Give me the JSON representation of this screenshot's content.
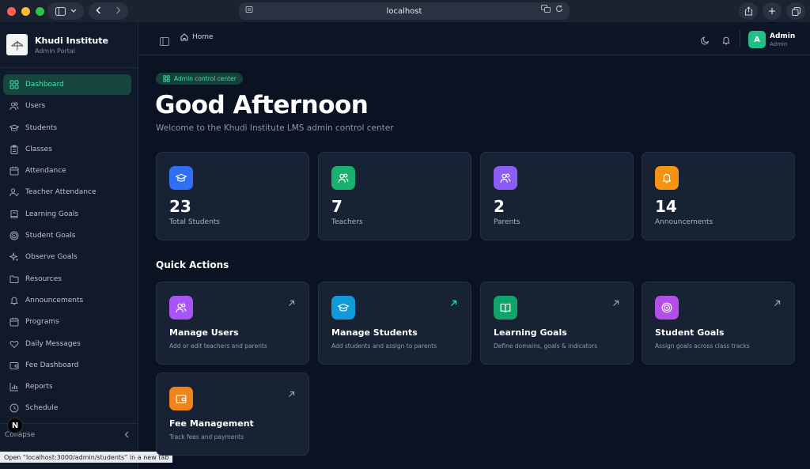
{
  "browser": {
    "url": "localhost"
  },
  "brand": {
    "title": "Khudi Institute",
    "subtitle": "Admin Portal"
  },
  "sidebar": {
    "items": [
      {
        "label": "Dashboard",
        "icon": "grid-icon",
        "active": true
      },
      {
        "label": "Users",
        "icon": "users-icon"
      },
      {
        "label": "Students",
        "icon": "graduation-cap-icon"
      },
      {
        "label": "Classes",
        "icon": "clipboard-icon"
      },
      {
        "label": "Attendance",
        "icon": "calendar-icon"
      },
      {
        "label": "Teacher Attendance",
        "icon": "user-check-icon"
      },
      {
        "label": "Learning Goals",
        "icon": "book-icon"
      },
      {
        "label": "Student Goals",
        "icon": "target-icon"
      },
      {
        "label": "Observe Goals",
        "icon": "sparkles-icon"
      },
      {
        "label": "Resources",
        "icon": "folder-icon"
      },
      {
        "label": "Announcements",
        "icon": "bell-icon"
      },
      {
        "label": "Programs",
        "icon": "calendar-icon"
      },
      {
        "label": "Daily Messages",
        "icon": "heart-icon"
      },
      {
        "label": "Fee Dashboard",
        "icon": "wallet-icon"
      },
      {
        "label": "Reports",
        "icon": "bar-chart-icon"
      },
      {
        "label": "Schedule",
        "icon": "clock-icon"
      }
    ],
    "collapse_label": "Collapse"
  },
  "topbar": {
    "breadcrumb": "Home",
    "user_name": "Admin",
    "user_role": "Admin",
    "avatar_letter": "A"
  },
  "hero": {
    "badge": "Admin control center",
    "greeting": "Good Afternoon",
    "welcome": "Welcome to the Khudi Institute LMS admin control center"
  },
  "stats": [
    {
      "value": "23",
      "label": "Total Students",
      "icon": "graduation-cap-icon",
      "color": "#2f6ff5"
    },
    {
      "value": "7",
      "label": "Teachers",
      "icon": "users-icon",
      "color": "#17b26f"
    },
    {
      "value": "2",
      "label": "Parents",
      "icon": "users-icon",
      "color": "#8b5cf6"
    },
    {
      "value": "14",
      "label": "Announcements",
      "icon": "bell-icon",
      "color": "#f59315"
    }
  ],
  "quick_actions": {
    "title": "Quick Actions",
    "items": [
      {
        "title": "Manage Users",
        "desc": "Add or edit teachers and parents",
        "icon": "users-icon"
      },
      {
        "title": "Manage Students",
        "desc": "Add students and assign to parents",
        "icon": "graduation-cap-icon"
      },
      {
        "title": "Learning Goals",
        "desc": "Define domains, goals & indicators",
        "icon": "book-open-icon"
      },
      {
        "title": "Student Goals",
        "desc": "Assign goals across class tracks",
        "icon": "target-icon"
      },
      {
        "title": "Fee Management",
        "desc": "Track fees and payments",
        "icon": "wallet-icon"
      }
    ]
  },
  "status_bar": "Open “localhost:3000/admin/students” in a new tab",
  "next_badge": "N"
}
